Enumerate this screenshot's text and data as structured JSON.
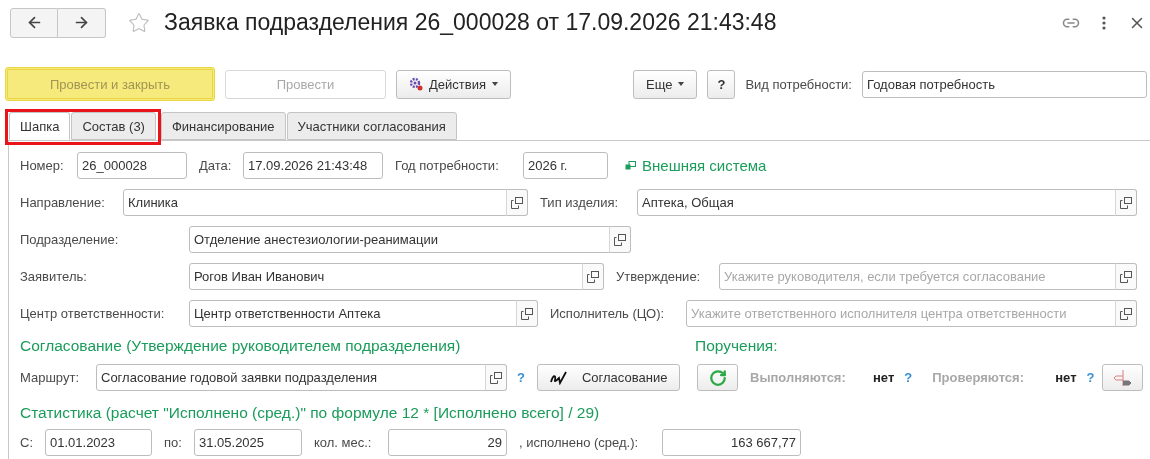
{
  "window": {
    "title": "Заявка подразделения 26_000028 от 17.09.2026 21:43:48",
    "favorite": false
  },
  "toolbar": {
    "buttons": [
      {
        "label": "Провести и закрыть",
        "kind": "primary",
        "disabled": false
      },
      {
        "label": "Провести",
        "kind": "plain",
        "disabled": true
      },
      {
        "label": "Действия",
        "kind": "actions",
        "disabled": false
      },
      {
        "label": "Еще",
        "kind": "menu",
        "disabled": false
      },
      {
        "label": "?",
        "kind": "help",
        "disabled": false
      }
    ],
    "need_type": {
      "label": "Вид потребности:",
      "value": "Годовая потребность"
    }
  },
  "tabs": [
    {
      "label": "Шапка",
      "selected": true,
      "highlighted": true
    },
    {
      "label": "Состав (3)",
      "selected": false,
      "highlighted": true
    },
    {
      "label": "Финансирование",
      "selected": false,
      "highlighted": false
    },
    {
      "label": "Участники согласования",
      "selected": false,
      "highlighted": false
    }
  ],
  "header": {
    "field_lines": [
      {
        "fields": [
          {
            "label": "Номер:",
            "value": "26_000028",
            "picker": false
          },
          {
            "label": "Дата:",
            "value": "17.09.2026 21:43:48",
            "picker": false
          },
          {
            "label": "Год потребности:",
            "value": "2026 г.",
            "picker": false
          }
        ]
      },
      {
        "fields": [
          {
            "label": "Направление:",
            "value": "Клиника",
            "picker": true
          },
          {
            "label": "Тип изделия:",
            "value": "Аптека, Общая",
            "picker": true
          }
        ]
      },
      {
        "fields": [
          {
            "label": "Подразделение:",
            "value": "Отделение анестезиологии-реанимации",
            "picker": true
          }
        ]
      },
      {
        "fields": [
          {
            "label": "Заявитель:",
            "value": "Рогов Иван Иванович",
            "picker": true
          },
          {
            "label": "Утверждение:",
            "placeholder": "Укажите руководителя, если требуется согласование",
            "picker": true
          }
        ]
      },
      {
        "fields": [
          {
            "label": "Центр ответственности:",
            "value": "Центр ответственности Аптека",
            "picker": true
          },
          {
            "label": "Исполнитель (ЦО):",
            "placeholder": "Укажите ответственного исполнителя центра ответственности",
            "picker": true
          }
        ]
      }
    ],
    "external_link": "Внешняя система"
  },
  "approval": {
    "title": "Согласование (Утверждение руководителем подразделения)",
    "route": {
      "label": "Маршрут:",
      "value": "Согласование годовой заявки подразделения",
      "picker": true
    },
    "help": "?",
    "button": "Согласование"
  },
  "tasks": {
    "title": "Поручения:",
    "items": [
      {
        "label": "Выполняются:",
        "value": "нет",
        "help": "?"
      },
      {
        "label": "Проверяются:",
        "value": "нет",
        "help": "?"
      }
    ]
  },
  "statistics": {
    "title": "Статистика (расчет \"Исполнено (сред.)\" по формуле 12 * [Исполнено всего] / 29)",
    "fields": [
      {
        "label": "С:",
        "value": "01.01.2023",
        "picker": false,
        "kind": "text"
      },
      {
        "label": "по:",
        "value": "31.05.2025",
        "picker": false,
        "kind": "text"
      },
      {
        "label": "кол. мес.:",
        "value": "29",
        "picker": false,
        "kind": "number"
      },
      {
        "label": ", исполнено (сред.):",
        "value": "163 667,77",
        "picker": false,
        "kind": "number"
      }
    ]
  }
}
